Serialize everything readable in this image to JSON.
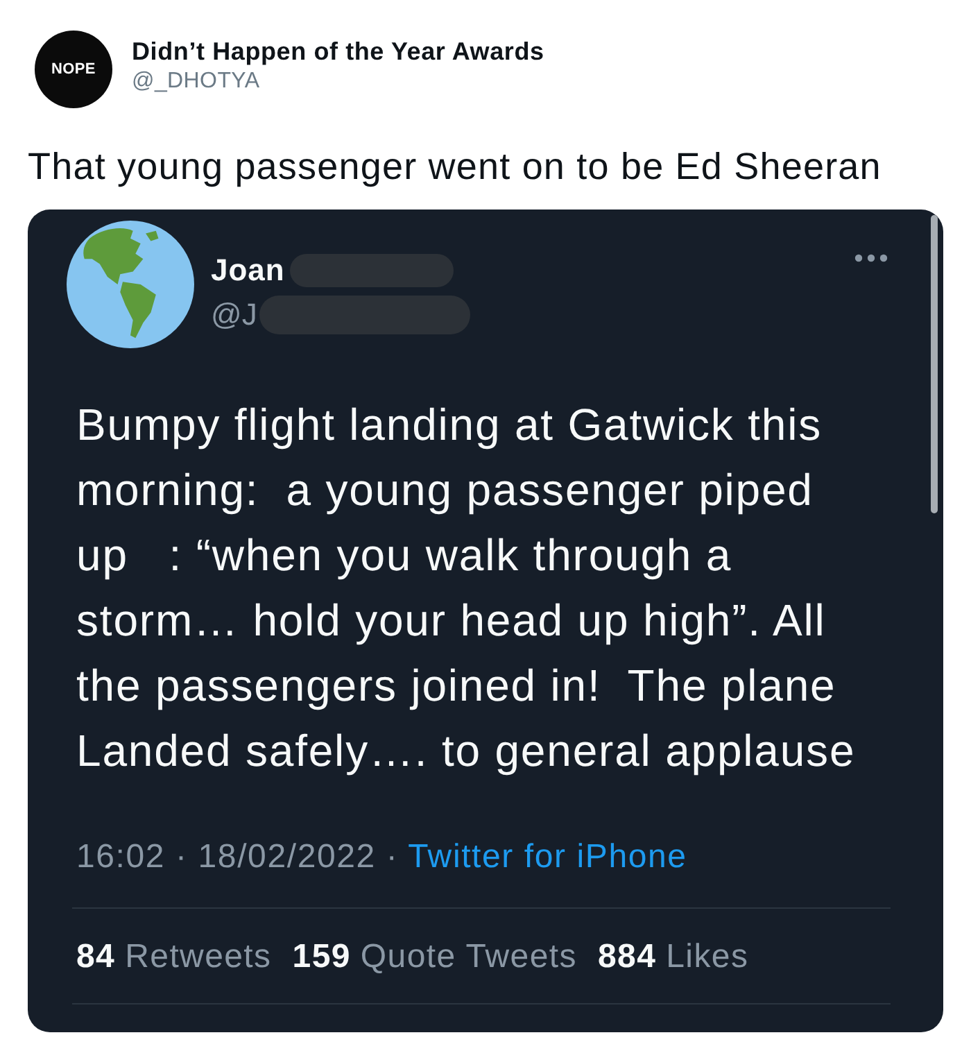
{
  "post": {
    "avatar_text": "NOPE",
    "name": "Didn’t Happen of the Year Awards",
    "handle": "@_DHOTYA",
    "caption": "That young passenger went on to be Ed Sheeran"
  },
  "embedded_tweet": {
    "name": "Joan",
    "handle": "@J",
    "text_lines": [
      "Bumpy flight landing at Gatwick this",
      "morning:  a young passenger piped",
      "up   : “when you walk through a",
      "storm… hold your head up high”. All",
      "the passengers joined in!  The plane",
      "Landed safely…. to general applause"
    ],
    "timestamp": "16:02 · 18/02/2022 ·",
    "source": "Twitter for iPhone",
    "stats": [
      {
        "count": "84",
        "label": "Retweets"
      },
      {
        "count": "159",
        "label": "Quote Tweets"
      },
      {
        "count": "884",
        "label": "Likes"
      }
    ]
  }
}
